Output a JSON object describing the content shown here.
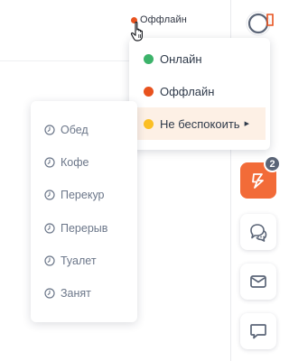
{
  "colors": {
    "online": "#3cb36a",
    "offline": "#e8521e",
    "dnd": "#fbbf24",
    "accent": "#f26b38",
    "highlight_bg": "#fdf0e5",
    "icon_gray": "#5b6577"
  },
  "status_indicator": {
    "label": "Оффлайн",
    "dot_color": "#e8521e"
  },
  "status_menu": {
    "items": [
      {
        "label": "Онлайн",
        "dot_color": "#3cb36a"
      },
      {
        "label": "Оффлайн",
        "dot_color": "#e8521e"
      },
      {
        "label": "Не беспокоить",
        "dot_color": "#fbbf24",
        "has_submenu": true,
        "highlighted": true
      }
    ]
  },
  "dnd_menu": {
    "icon": "clock-icon",
    "items": [
      {
        "label": "Обед"
      },
      {
        "label": "Кофе"
      },
      {
        "label": "Перекур"
      },
      {
        "label": "Перерыв"
      },
      {
        "label": "Туалет"
      },
      {
        "label": "Занят"
      }
    ]
  },
  "rail": {
    "top_icon": "search-phone-icon",
    "buttons": [
      {
        "icon": "tasks-icon",
        "active": true,
        "badge": "2"
      },
      {
        "icon": "chats-icon"
      },
      {
        "icon": "mail-icon"
      },
      {
        "icon": "comment-icon"
      }
    ]
  }
}
